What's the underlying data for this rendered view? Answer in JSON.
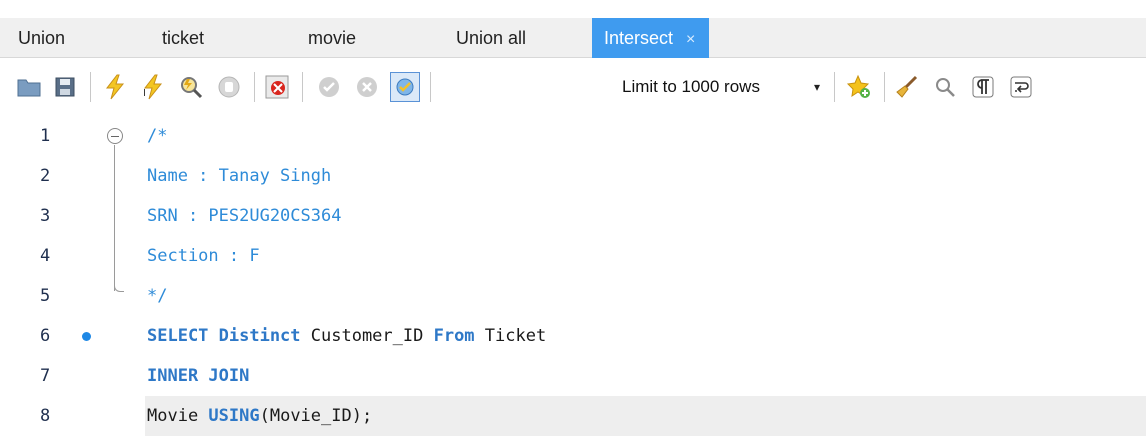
{
  "tabs": [
    {
      "label": "Union"
    },
    {
      "label": "ticket"
    },
    {
      "label": "movie"
    },
    {
      "label": "Union all"
    },
    {
      "label": "Intersect",
      "close": "×",
      "active": true
    }
  ],
  "toolbar": {
    "icons": [
      "open-folder-icon",
      "save-icon",
      "execute-icon",
      "execute-current-icon",
      "explain-icon",
      "stop-icon",
      "toggle-error-icon",
      "commit-icon",
      "rollback-icon",
      "autocommit-icon",
      "bookmark-icon",
      "beautify-icon",
      "find-icon",
      "invisible-chars-icon",
      "word-wrap-icon"
    ],
    "limit_label": "Limit to 1000 rows",
    "limit_arrow": "▾"
  },
  "editor": {
    "lines": [
      {
        "num": "1",
        "text": "/*"
      },
      {
        "num": "2",
        "text": "Name : Tanay Singh"
      },
      {
        "num": "3",
        "text": "SRN : PES2UG20CS364"
      },
      {
        "num": "4",
        "text": "Section : F"
      },
      {
        "num": "5",
        "text": "*/"
      },
      {
        "num": "6",
        "kw1": "SELECT Distinct",
        "id1": " Customer_ID ",
        "kw2": "From",
        "id2": " Ticket"
      },
      {
        "num": "7",
        "kw1": "INNER JOIN"
      },
      {
        "num": "8",
        "id1": "Movie ",
        "kw1": "USING",
        "id2": "(Movie_ID);"
      }
    ]
  },
  "colors": {
    "active_tab": "#3f9bef",
    "keyword": "#2e78c7",
    "comment": "#2e8bd8",
    "gutter_dot": "#1e88e5"
  }
}
